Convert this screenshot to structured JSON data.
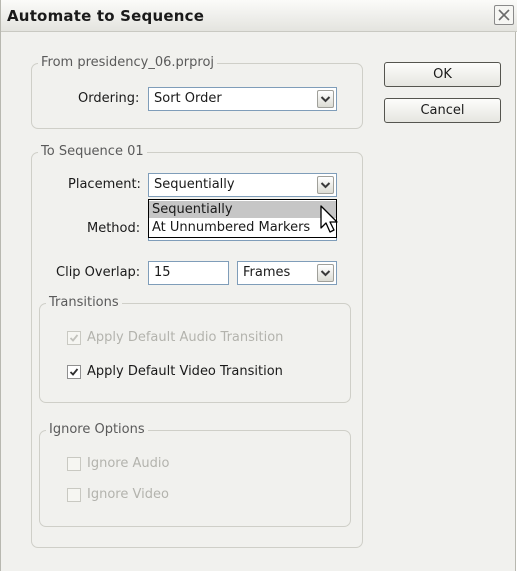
{
  "dialog": {
    "title": "Automate to Sequence"
  },
  "from_group": {
    "legend": "From presidency_06.prproj",
    "ordering_label": "Ordering:",
    "ordering_value": "Sort Order"
  },
  "buttons": {
    "ok": "OK",
    "cancel": "Cancel"
  },
  "to_group": {
    "legend": "To Sequence 01",
    "placement_label": "Placement:",
    "placement_value": "Sequentially",
    "placement_options": [
      "Sequentially",
      "At Unnumbered Markers"
    ],
    "method_label": "Method:",
    "clip_overlap_label": "Clip Overlap:",
    "clip_overlap_value": "15",
    "clip_overlap_unit": "Frames"
  },
  "transitions": {
    "legend": "Transitions",
    "apply_audio": {
      "label": "Apply Default Audio Transition",
      "checked": true,
      "enabled": false
    },
    "apply_video": {
      "label": "Apply Default Video Transition",
      "checked": true,
      "enabled": true
    }
  },
  "ignore_options": {
    "legend": "Ignore Options",
    "ignore_audio": {
      "label": "Ignore Audio",
      "checked": false,
      "enabled": false
    },
    "ignore_video": {
      "label": "Ignore Video",
      "checked": false,
      "enabled": false
    }
  },
  "colors": {
    "dialog_bg": "#f1f1ee",
    "dropdown_highlight": "#c6c6c6",
    "input_border": "#7f9db9"
  }
}
